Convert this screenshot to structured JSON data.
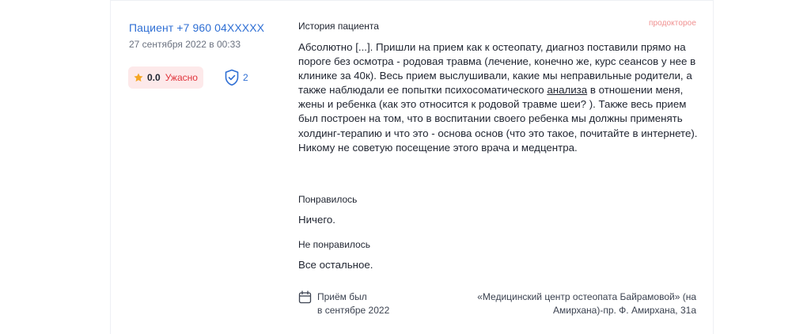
{
  "review": {
    "author": "Пациент +7 960 04XXXXX",
    "date": "27 сентября 2022 в 00:33",
    "rating": {
      "value": "0.0",
      "label": "Ужасно",
      "color": "#e0343c",
      "icon": "star-icon"
    },
    "verified_count": "2",
    "source": "продокторое",
    "history_title": "История пациента",
    "text_before_link": "Абсолютно [...]. Пришли на прием как к остеопату, диагноз поставили прямо на пороге без осмотра - родовая травма (лечение, конечно же, курс сеансов у нее в клинике за 40к). Весь прием выслушивали, какие мы неправильные родители, а также наблюдали ее попытки психосоматического ",
    "text_link": "анализа",
    "text_after_link": " в отношении меня, жены и ребенка (как это относится к родовой травме шеи? ). Также весь прием был построен на том, что в воспитании своего ребенка мы должны применять холдинг-терапию и что это - основа основ (что это такое, почитайте в интернете). Никому не советую посещение этого врача и медцентра.",
    "liked_title": "Понравилось",
    "liked_text": "Ничего.",
    "disliked_title": "Не понравилось",
    "disliked_text": "Все остальное.",
    "visit_line1": "Приём был",
    "visit_line2": "в сентябре 2022",
    "clinic_line1": "«Медицинский центр остеопата Байрамовой» (на",
    "clinic_line2": "Амирхана)-пр. Ф. Амирхана, 31а"
  }
}
